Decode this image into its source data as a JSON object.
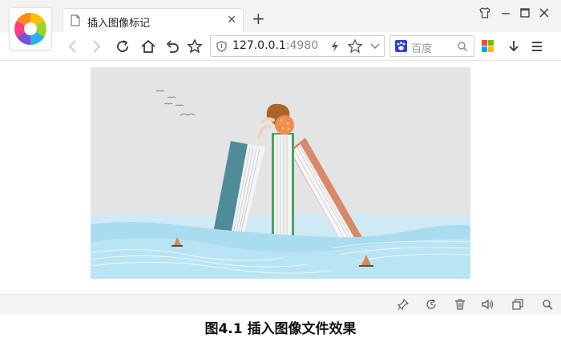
{
  "browser": {
    "logo": "360-browser-logo",
    "tab": {
      "title": "插入图像标记",
      "icon": "document-icon"
    },
    "address": {
      "host": "127.0.0.1",
      "port": ":4980"
    },
    "search": {
      "engine": "baidu",
      "placeholder": "百度"
    },
    "window_controls": [
      "shirt-skin-icon",
      "minimize-icon",
      "maximize-icon",
      "close-icon"
    ]
  },
  "statusbar": {
    "icons": [
      "pin-icon",
      "refresh-clock-icon",
      "trash-icon",
      "speaker-icon",
      "window-icon",
      "zoom-icon"
    ]
  },
  "content": {
    "image": "illustration-books-in-sea"
  },
  "caption": "图4.1  插入图像文件效果",
  "colors": {
    "sky": "#e4e4e4",
    "sea": "#a8dcee",
    "book_teal": "#4f8c98",
    "book_green": "#4ca060",
    "book_orange": "#d7896a"
  }
}
